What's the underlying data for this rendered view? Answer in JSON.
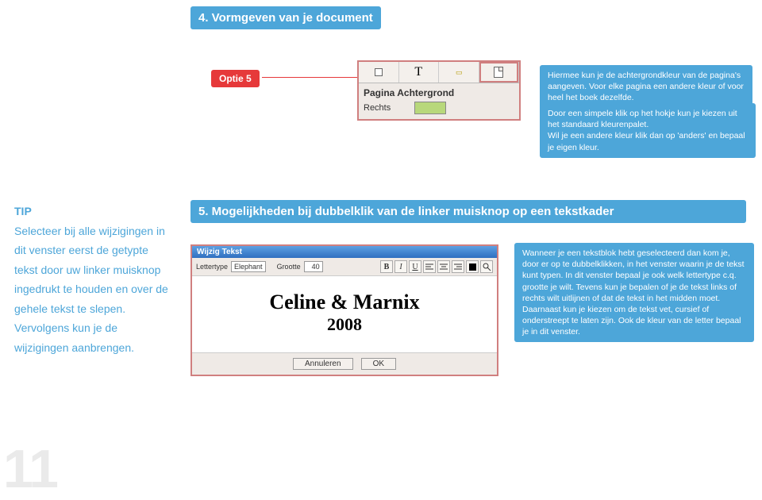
{
  "heading4": "4. Vormgeven van je document",
  "optie": "Optie 5",
  "shot1": {
    "title": "Pagina Achtergrond",
    "leftLabel": "Rechts",
    "iconT": "T"
  },
  "copy1": "Hiermee kun je de achtergrondkleur van de pagina's aangeven. Voor elke pagina een andere kleur of voor heel het boek dezelfde.",
  "copy2": "Door een simpele klik op het hokje kun je kiezen uit het standaard kleurenpalet.\nWil je een andere kleur klik dan op 'anders' en bepaal je eigen kleur.",
  "tip": {
    "title": "TIP",
    "body": "Selecteer bij alle wijzigingen in dit venster eerst de getypte tekst door uw linker muisknop ingedrukt te houden en over de gehele tekst te slepen. Vervolgens kun je de wijzigingen aanbrengen."
  },
  "heading5": "5. Mogelijkheden bij dubbelklik van de linker muisknop op een tekstkader",
  "shot2": {
    "titlebar": "Wijzig Tekst",
    "fontLabel": "Lettertype",
    "fontValue": "Elephant",
    "sizeLabel": "Grootte",
    "sizeValue": "40",
    "icons": {
      "b": "B",
      "i": "I",
      "u": "U"
    },
    "bigText": "Celine & Marnix",
    "yearText": "2008",
    "btnCancel": "Annuleren",
    "btnOk": "OK"
  },
  "copy3": "Wanneer je een tekstblok hebt geselecteerd dan kom je, door er op te dubbelklikken, in het venster waarin je de tekst kunt typen. In dit venster bepaal je ook welk lettertype c.q. grootte je wilt. Tevens kun je bepalen of je de tekst links of rechts wilt uitlijnen of dat de tekst in het midden moet. Daarnaast kun je kiezen om de tekst vet, cursief of onderstreept te laten zijn. Ook de kleur van de letter bepaal je in dit venster.",
  "pageNumber": "11"
}
